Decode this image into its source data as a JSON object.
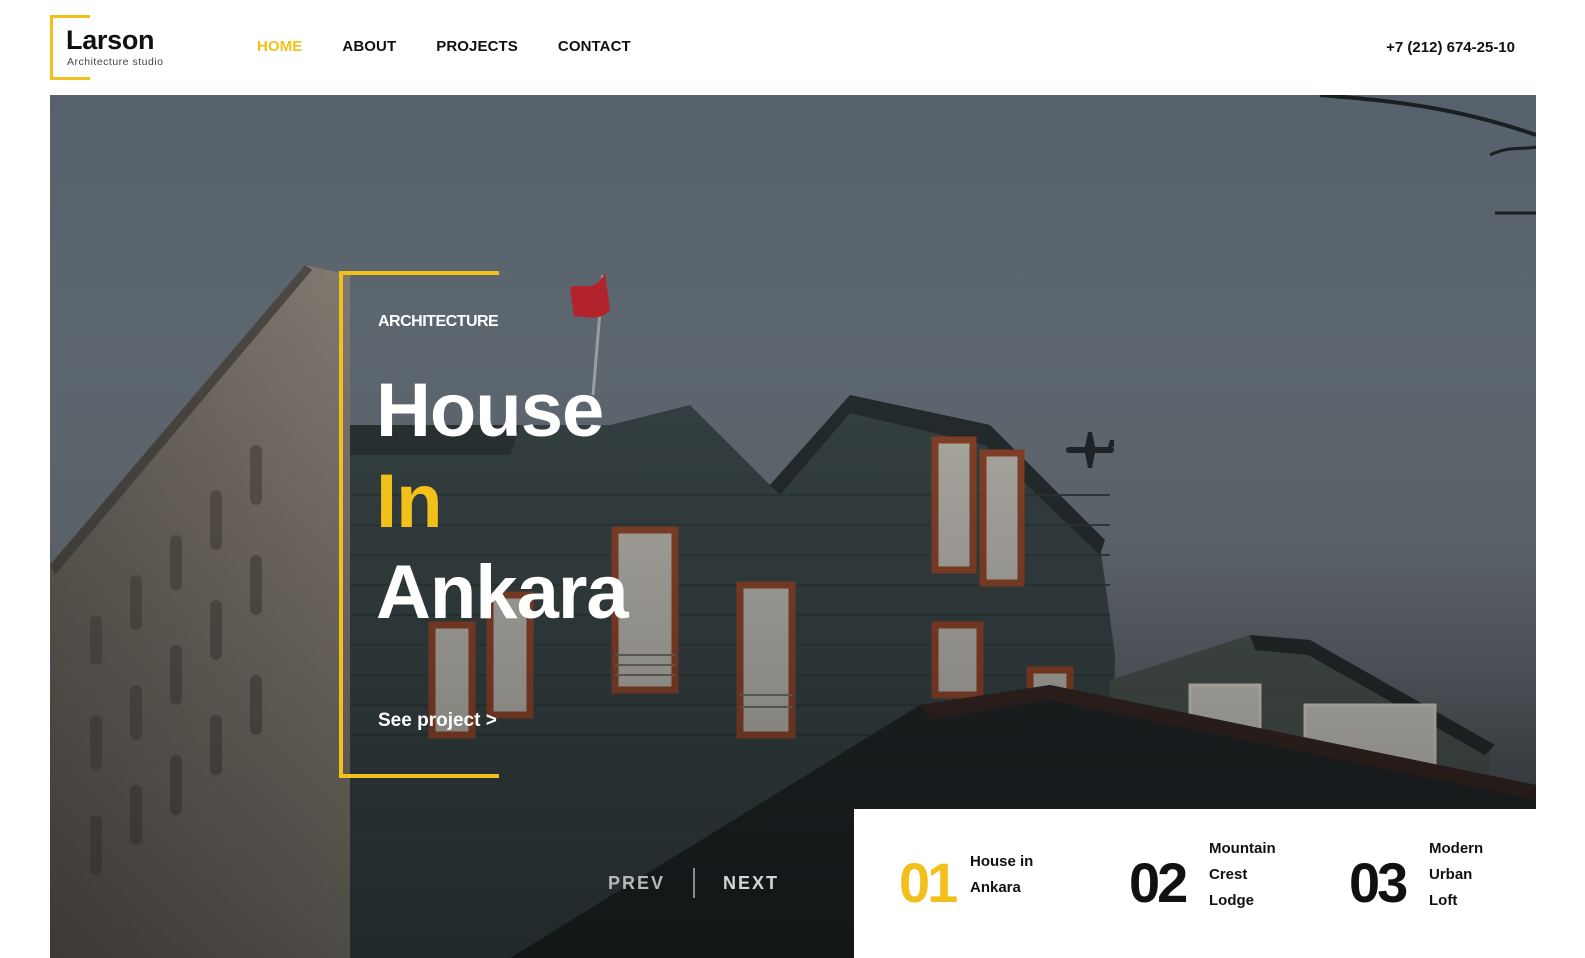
{
  "brand": {
    "name": "Larson",
    "tagline": "Architecture studio",
    "accent_color": "#f2c01b"
  },
  "nav": {
    "items": [
      {
        "label": "HOME",
        "active": true
      },
      {
        "label": "ABOUT",
        "active": false
      },
      {
        "label": "PROJECTS",
        "active": false
      },
      {
        "label": "CONTACT",
        "active": false
      }
    ]
  },
  "header": {
    "phone": "+7 (212) 674-25-10"
  },
  "hero": {
    "kicker": "ARCHITECTURE",
    "title_line1": "House",
    "title_line2": "In",
    "title_line3": "Ankara",
    "cta": "See project >",
    "background": "photo-of-house-with-flag-and-airplane"
  },
  "pager": {
    "prev": "PREV",
    "next": "NEXT"
  },
  "projects": [
    {
      "number": "01",
      "title_lines": [
        "House in",
        "Ankara"
      ],
      "active": true
    },
    {
      "number": "02",
      "title_lines": [
        "Mountain",
        "Crest",
        "Lodge"
      ],
      "active": false
    },
    {
      "number": "03",
      "title_lines": [
        "Modern",
        "Urban",
        "Loft"
      ],
      "active": false
    }
  ]
}
